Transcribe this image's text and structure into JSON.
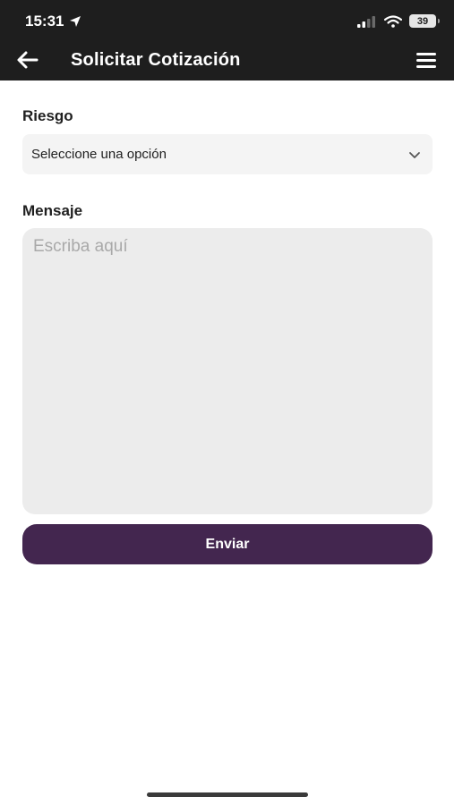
{
  "status_bar": {
    "time": "15:31",
    "battery": "39",
    "icons": [
      "location-arrow-icon",
      "signal-icon",
      "wifi-icon",
      "battery-icon"
    ]
  },
  "header": {
    "title": "Solicitar Cotización",
    "back_icon": "arrow-left-icon",
    "menu_icon": "hamburger-menu-icon",
    "background": "#1e1e1e"
  },
  "form": {
    "risk_label": "Riesgo",
    "risk_select_value": "Seleccione una opción",
    "message_label": "Mensaje",
    "message_placeholder": "Escriba aquí",
    "message_value": "",
    "submit_label": "Enviar"
  },
  "colors": {
    "accent": "#43264f",
    "field_background": "#f4f4f4",
    "textarea_background": "#ececec"
  }
}
